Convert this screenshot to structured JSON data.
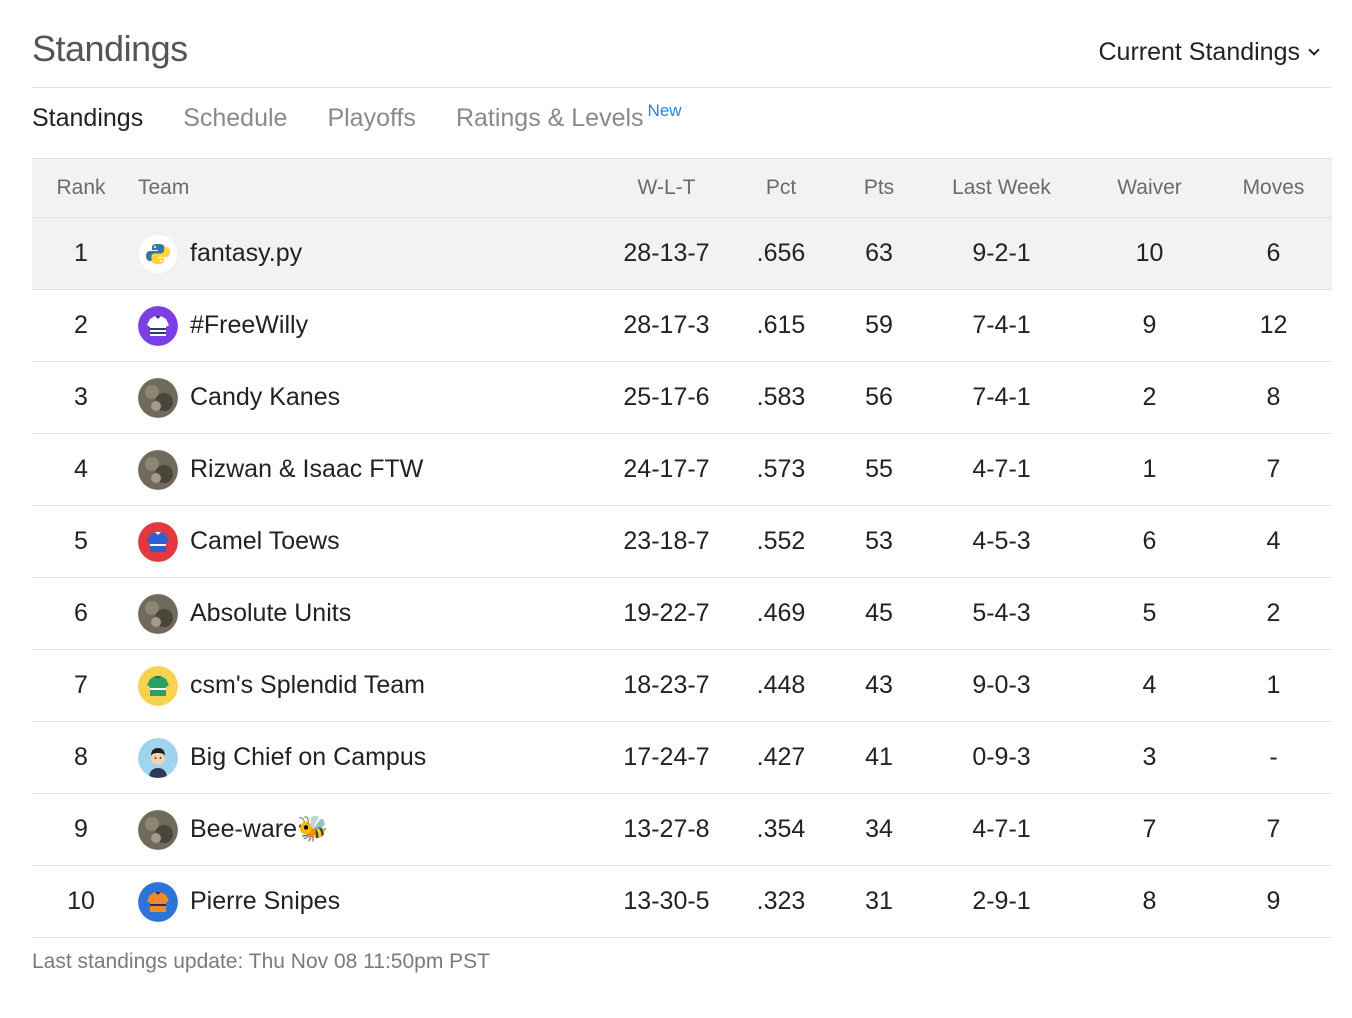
{
  "header": {
    "title": "Standings",
    "view_select": "Current Standings"
  },
  "tabs": [
    {
      "label": "Standings",
      "active": true
    },
    {
      "label": "Schedule",
      "active": false
    },
    {
      "label": "Playoffs",
      "active": false
    },
    {
      "label": "Ratings & Levels",
      "badge": "New",
      "active": false
    }
  ],
  "columns": {
    "rank": "Rank",
    "team": "Team",
    "wlt": "W-L-T",
    "pct": "Pct",
    "pts": "Pts",
    "last_week": "Last Week",
    "waiver": "Waiver",
    "moves": "Moves"
  },
  "rows": [
    {
      "rank": "1",
      "team": "fantasy.py",
      "avatar": "python-logo-avatar",
      "wlt": "28-13-7",
      "pct": ".656",
      "pts": "63",
      "last_week": "9-2-1",
      "waiver": "10",
      "moves": "6",
      "highlight": true
    },
    {
      "rank": "2",
      "team": "#FreeWilly",
      "avatar": "purple-jersey-avatar",
      "wlt": "28-17-3",
      "pct": ".615",
      "pts": "59",
      "last_week": "7-4-1",
      "waiver": "9",
      "moves": "12"
    },
    {
      "rank": "3",
      "team": "Candy Kanes",
      "avatar": "photo-avatar",
      "wlt": "25-17-6",
      "pct": ".583",
      "pts": "56",
      "last_week": "7-4-1",
      "waiver": "2",
      "moves": "8"
    },
    {
      "rank": "4",
      "team": "Rizwan & Isaac FTW",
      "avatar": "photo-avatar",
      "wlt": "24-17-7",
      "pct": ".573",
      "pts": "55",
      "last_week": "4-7-1",
      "waiver": "1",
      "moves": "7"
    },
    {
      "rank": "5",
      "team": "Camel Toews",
      "avatar": "red-jersey-avatar",
      "wlt": "23-18-7",
      "pct": ".552",
      "pts": "53",
      "last_week": "4-5-3",
      "waiver": "6",
      "moves": "4"
    },
    {
      "rank": "6",
      "team": "Absolute Units",
      "avatar": "photo-avatar",
      "wlt": "19-22-7",
      "pct": ".469",
      "pts": "45",
      "last_week": "5-4-3",
      "waiver": "5",
      "moves": "2"
    },
    {
      "rank": "7",
      "team": "csm's Splendid Team",
      "avatar": "yellow-jersey-avatar",
      "wlt": "18-23-7",
      "pct": ".448",
      "pts": "43",
      "last_week": "9-0-3",
      "waiver": "4",
      "moves": "1"
    },
    {
      "rank": "8",
      "team": "Big Chief on Campus",
      "avatar": "person-avatar",
      "wlt": "17-24-7",
      "pct": ".427",
      "pts": "41",
      "last_week": "0-9-3",
      "waiver": "3",
      "moves": "-"
    },
    {
      "rank": "9",
      "team": "Bee-ware🐝",
      "avatar": "photo-avatar",
      "wlt": "13-27-8",
      "pct": ".354",
      "pts": "34",
      "last_week": "4-7-1",
      "waiver": "7",
      "moves": "7"
    },
    {
      "rank": "10",
      "team": "Pierre Snipes",
      "avatar": "blue-jersey-avatar",
      "wlt": "13-30-5",
      "pct": ".323",
      "pts": "31",
      "last_week": "2-9-1",
      "waiver": "8",
      "moves": "9"
    }
  ],
  "footer": {
    "update_text": "Last standings update: Thu Nov 08 11:50pm PST"
  },
  "colors": {
    "accent": "#1e88e5",
    "header_bg": "#f2f2f2",
    "border": "#e2e2e2",
    "muted_text": "#8a8a8a"
  }
}
